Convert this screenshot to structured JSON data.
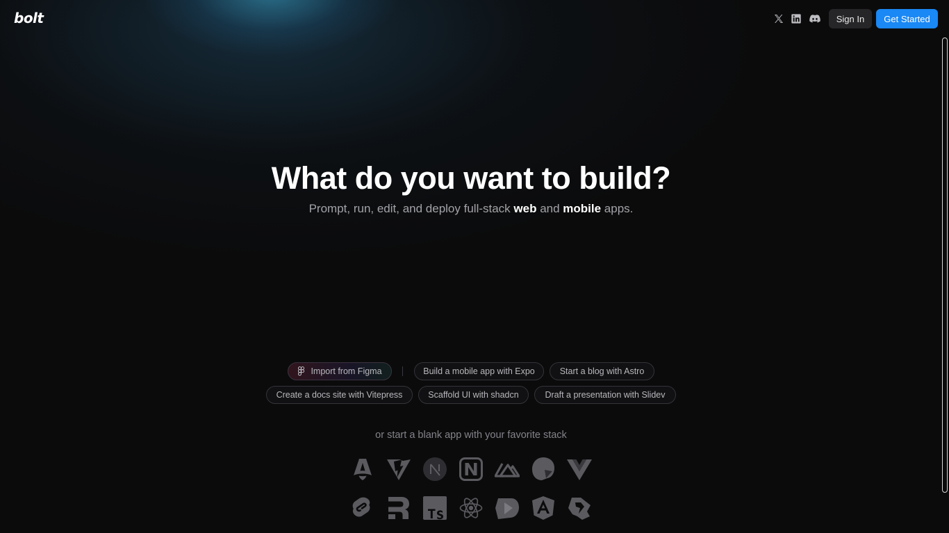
{
  "header": {
    "logo_text": "bolt",
    "social": [
      {
        "name": "x-twitter-icon"
      },
      {
        "name": "linkedin-icon"
      },
      {
        "name": "discord-icon"
      }
    ],
    "sign_in_label": "Sign In",
    "get_started_label": "Get Started"
  },
  "hero": {
    "title": "What do you want to build?",
    "subtitle_pre": "Prompt, run, edit, and deploy full-stack ",
    "subtitle_web": "web",
    "subtitle_mid": " and ",
    "subtitle_mobile": "mobile",
    "subtitle_post": " apps."
  },
  "chips": [
    {
      "label": "Import from Figma"
    },
    {
      "label": "Build a mobile app with Expo"
    },
    {
      "label": "Start a blog with Astro"
    },
    {
      "label": "Create a docs site with Vitepress"
    },
    {
      "label": "Scaffold UI with shadcn"
    },
    {
      "label": "Draft a presentation with Slidev"
    }
  ],
  "blank_app_text": "or start a blank app with your favorite stack",
  "stacks": [
    {
      "name": "astro-icon"
    },
    {
      "name": "vite-icon"
    },
    {
      "name": "nextjs-icon"
    },
    {
      "name": "nuxt-icon"
    },
    {
      "name": "nuxt-mountain-icon"
    },
    {
      "name": "slidev-icon"
    },
    {
      "name": "vue-icon"
    },
    {
      "name": "svelte-icon"
    },
    {
      "name": "remix-icon"
    },
    {
      "name": "typescript-icon"
    },
    {
      "name": "react-icon"
    },
    {
      "name": "qwik-icon"
    },
    {
      "name": "angular-icon"
    },
    {
      "name": "solid-icon"
    }
  ],
  "colors": {
    "background": "#0b0b0c",
    "accent": "#1a88f5",
    "glow": "#2aa6d6",
    "icon_gray": "#5a5a5f"
  }
}
